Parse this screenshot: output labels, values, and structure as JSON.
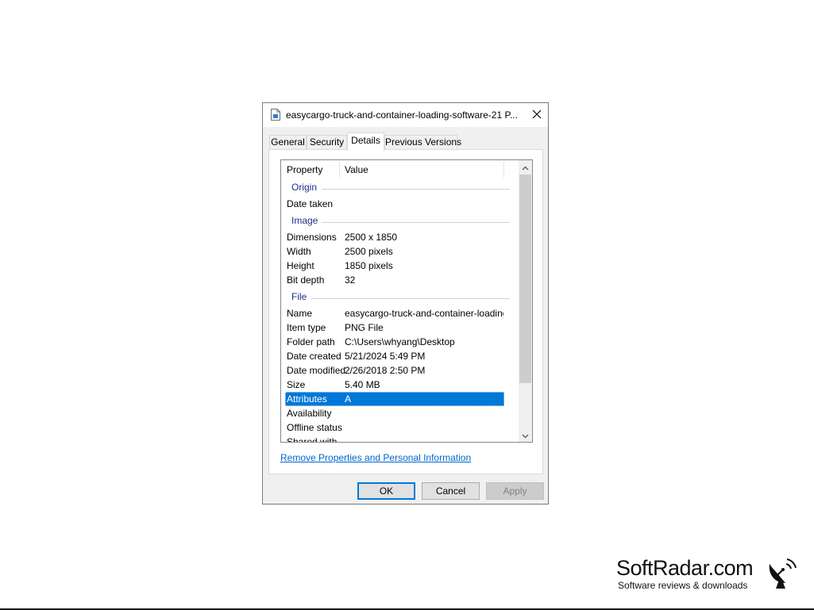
{
  "dialog": {
    "title": "easycargo-truck-and-container-loading-software-21 P...",
    "tabs": [
      {
        "label": "General",
        "active": false
      },
      {
        "label": "Security",
        "active": false
      },
      {
        "label": "Details",
        "active": true
      },
      {
        "label": "Previous Versions",
        "active": false
      }
    ],
    "columns": {
      "property": "Property",
      "value": "Value"
    },
    "groups": {
      "origin": "Origin",
      "image": "Image",
      "file": "File"
    },
    "rows": {
      "date_taken": {
        "property": "Date taken",
        "value": ""
      },
      "dimensions": {
        "property": "Dimensions",
        "value": "2500 x 1850"
      },
      "width": {
        "property": "Width",
        "value": "2500 pixels"
      },
      "height": {
        "property": "Height",
        "value": "1850 pixels"
      },
      "bit_depth": {
        "property": "Bit depth",
        "value": "32"
      },
      "name": {
        "property": "Name",
        "value": "easycargo-truck-and-container-loading-..."
      },
      "item_type": {
        "property": "Item type",
        "value": "PNG File"
      },
      "folder_path": {
        "property": "Folder path",
        "value": "C:\\Users\\whyang\\Desktop"
      },
      "date_created": {
        "property": "Date created",
        "value": "5/21/2024 5:49 PM"
      },
      "date_modified": {
        "property": "Date modified",
        "value": "2/26/2018 2:50 PM"
      },
      "size": {
        "property": "Size",
        "value": "5.40 MB"
      },
      "attributes": {
        "property": "Attributes",
        "value": "A"
      },
      "availability": {
        "property": "Availability",
        "value": ""
      },
      "offline_status": {
        "property": "Offline status",
        "value": ""
      },
      "shared_with": {
        "property": "Shared with",
        "value": ""
      }
    },
    "remove_link": "Remove Properties and Personal Information",
    "buttons": {
      "ok": "OK",
      "cancel": "Cancel",
      "apply": "Apply"
    },
    "icons": {
      "file": "file-icon",
      "close": "close-icon",
      "scroll_up": "chevron-up-icon",
      "scroll_down": "chevron-down-icon"
    }
  },
  "watermark": {
    "title": "SoftRadar.com",
    "subtitle": "Software reviews & downloads",
    "logo": "satellite-dish-icon"
  },
  "colors": {
    "selection": "#0078d7",
    "group_label": "#1e3287",
    "link": "#0066cc"
  }
}
